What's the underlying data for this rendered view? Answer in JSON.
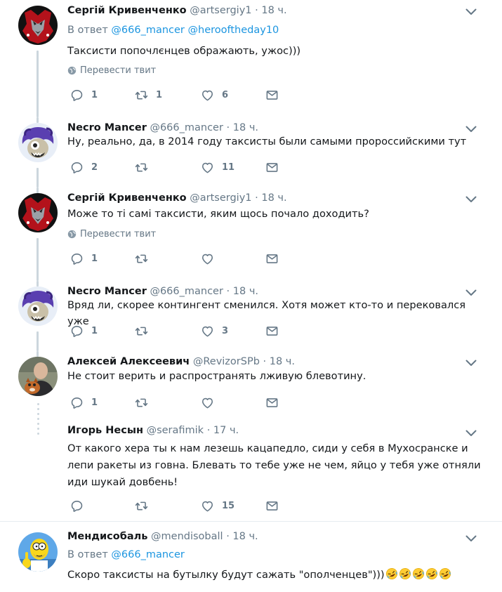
{
  "colors": {
    "link": "#1b95e0",
    "secondary": "#657786",
    "line": "#ccd6dd",
    "text": "#14171a"
  },
  "icons": {
    "reply": "reply-icon",
    "retweet": "retweet-icon",
    "like": "heart-icon",
    "dm": "envelope-icon",
    "caret": "chevron-down-icon",
    "globe": "globe-icon",
    "emoji": "rolling-on-floor-laughing-emoji"
  },
  "tweets": [
    {
      "name": "Сергій Кривенченко",
      "handle": "@artsergiy1",
      "dot": "·",
      "time": "18 ч.",
      "reply_prefix": "В ответ",
      "reply_mentions": [
        "@666_mancer",
        "@herooftheday10"
      ],
      "text": "Таксисти попочлєнцев ображають, ужос)))",
      "translate": "Перевести твит",
      "replies": "1",
      "retweets": "1",
      "likes": "6"
    },
    {
      "name": "Necro Mancer",
      "handle": "@666_mancer",
      "dot": "·",
      "time": "18 ч.",
      "text": "Ну, реально, да, в 2014 году таксисты были самыми пророссийскими тут",
      "replies": "2",
      "retweets": "",
      "likes": "11"
    },
    {
      "name": "Сергій Кривенченко",
      "handle": "@artsergiy1",
      "dot": "·",
      "time": "18 ч.",
      "text": "Може то ті самі таксисти, яким щось почало доходить?",
      "translate": "Перевести твит",
      "replies": "1",
      "retweets": "",
      "likes": ""
    },
    {
      "name": "Necro Mancer",
      "handle": "@666_mancer",
      "dot": "·",
      "time": "18 ч.",
      "text": "Вряд ли, скорее контингент сменился. Хотя может кто-то и перековался уже",
      "replies": "1",
      "retweets": "",
      "likes": "3"
    },
    {
      "name": "Алексей Алексеевич",
      "handle": "@RevizorSPb",
      "dot": "·",
      "time": "18 ч.",
      "text": "Не стоит верить и распространять лживую блевотину.",
      "replies": "1",
      "retweets": "",
      "likes": ""
    },
    {
      "name": "Игорь Несын",
      "handle": "@serafimik",
      "dot": "·",
      "time": "17 ч.",
      "text": "От какого хера ты к нам лезешь кацапедло, сиди у себя в Мухосранске и лепи ракеты из говна. Блевать то тебе уже не чем, яйцо у тебя уже отняли иди шукай довбень!",
      "replies": "",
      "retweets": "",
      "likes": "15"
    },
    {
      "name": "Мендисобаль",
      "handle": "@mendisoball",
      "dot": "·",
      "time": "18 ч.",
      "reply_prefix": "В ответ",
      "reply_mentions": [
        "@666_mancer"
      ],
      "text": "Скоро таксисты на бутылку будут сажать \"ополченцев\")))"
    }
  ]
}
